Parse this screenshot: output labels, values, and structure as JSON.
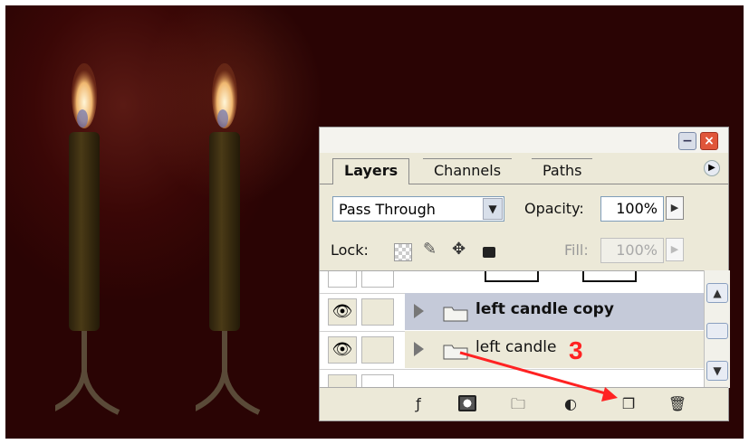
{
  "panel": {
    "tabs": [
      {
        "label": "Layers",
        "active": true
      },
      {
        "label": "Channels",
        "active": false
      },
      {
        "label": "Paths",
        "active": false
      }
    ],
    "blend_mode": "Pass Through",
    "opacity_label": "Opacity:",
    "opacity_value": "100%",
    "lock_label": "Lock:",
    "fill_label": "Fill:",
    "fill_value": "100%",
    "layers": [
      {
        "name": "",
        "type": "layer-with-mask",
        "visible": false,
        "selected": false
      },
      {
        "name": "left candle copy",
        "type": "group",
        "visible": true,
        "selected": true
      },
      {
        "name": "left candle",
        "type": "group",
        "visible": true,
        "selected": false
      }
    ],
    "bottom_icons": [
      "link-layers-icon",
      "layer-style-icon",
      "add-mask-icon",
      "new-group-icon",
      "adjustment-layer-icon",
      "new-layer-icon",
      "delete-layer-icon"
    ]
  },
  "annotation": {
    "number": "3",
    "color": "#ff2222"
  },
  "colors": {
    "canvas_background": "#3a0706",
    "panel_background": "#ece9d8",
    "selected_layer": "#c5cad9"
  }
}
